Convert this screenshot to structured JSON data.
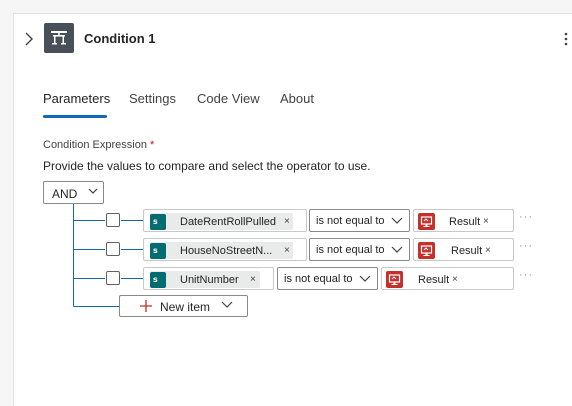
{
  "header": {
    "title": "Condition 1",
    "icon": "condition-icon",
    "accent": "#484f58"
  },
  "tabs": [
    {
      "label": "Parameters",
      "active": true
    },
    {
      "label": "Settings",
      "active": false
    },
    {
      "label": "Code View",
      "active": false
    },
    {
      "label": "About",
      "active": false
    }
  ],
  "form": {
    "section_label": "Condition Expression",
    "required_mark": "*",
    "help_text": "Provide the values to compare and select the operator to use.",
    "group_operator": "AND"
  },
  "rows": [
    {
      "left_token": "DateRentRollPulled",
      "operator": "is not equal to",
      "right_token": "Result"
    },
    {
      "left_token": "HouseNoStreetN...",
      "operator": "is not equal to",
      "right_token": "Result"
    },
    {
      "left_token": "UnitNumber",
      "operator": "is not equal to",
      "right_token": "Result"
    }
  ],
  "new_item_label": "New item",
  "colors": {
    "active_tab_underline": "#1466b8",
    "sharepoint_icon": "#036c70",
    "result_icon": "#c4302b"
  }
}
